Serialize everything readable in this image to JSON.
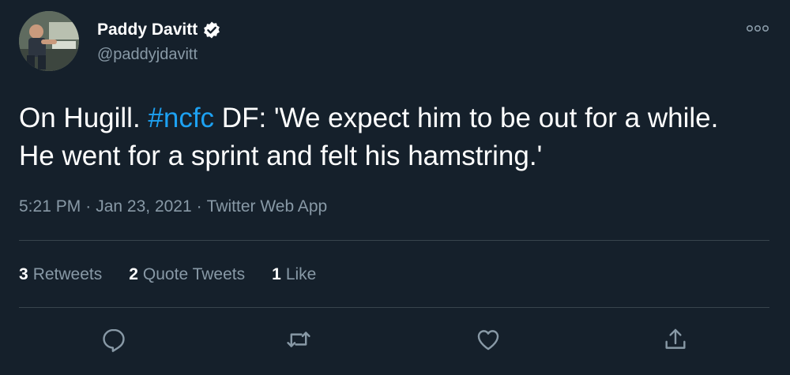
{
  "author": {
    "name": "Paddy Davitt",
    "handle": "@paddyjdavitt",
    "verified": true
  },
  "tweet": {
    "text_before": "On Hugill. ",
    "hashtag": "#ncfc",
    "text_after": " DF: 'We expect him to be out for a while. He went for a sprint and felt his hamstring.'"
  },
  "meta": {
    "time": "5:21 PM",
    "separator": "·",
    "date": "Jan 23, 2021",
    "source": "Twitter Web App"
  },
  "stats": {
    "retweets_count": "3",
    "retweets_label": "Retweets",
    "quotes_count": "2",
    "quotes_label": "Quote Tweets",
    "likes_count": "1",
    "likes_label": "Like"
  },
  "colors": {
    "background": "#15202b",
    "text": "#ffffff",
    "muted": "#8899a6",
    "accent": "#1da1f2",
    "divider": "#38444d"
  },
  "icons": {
    "more": "more-options-icon",
    "verified": "verified-badge-icon",
    "reply": "reply-icon",
    "retweet": "retweet-icon",
    "like": "like-icon",
    "share": "share-icon"
  }
}
